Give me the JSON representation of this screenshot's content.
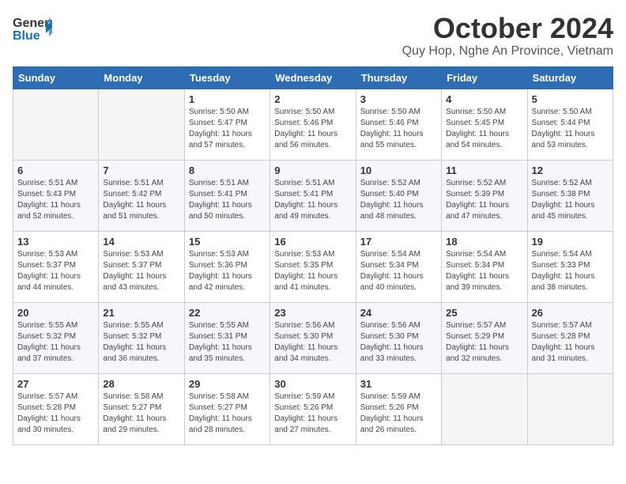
{
  "header": {
    "logo_text_general": "General",
    "logo_text_blue": "Blue",
    "month_title": "October 2024",
    "location": "Quy Hop, Nghe An Province, Vietnam"
  },
  "weekdays": [
    "Sunday",
    "Monday",
    "Tuesday",
    "Wednesday",
    "Thursday",
    "Friday",
    "Saturday"
  ],
  "weeks": [
    [
      {
        "day": null
      },
      {
        "day": null
      },
      {
        "day": "1",
        "sunrise": "5:50 AM",
        "sunset": "5:47 PM",
        "daylight": "11 hours and 57 minutes."
      },
      {
        "day": "2",
        "sunrise": "5:50 AM",
        "sunset": "5:46 PM",
        "daylight": "11 hours and 56 minutes."
      },
      {
        "day": "3",
        "sunrise": "5:50 AM",
        "sunset": "5:46 PM",
        "daylight": "11 hours and 55 minutes."
      },
      {
        "day": "4",
        "sunrise": "5:50 AM",
        "sunset": "5:45 PM",
        "daylight": "11 hours and 54 minutes."
      },
      {
        "day": "5",
        "sunrise": "5:50 AM",
        "sunset": "5:44 PM",
        "daylight": "11 hours and 53 minutes."
      }
    ],
    [
      {
        "day": "6",
        "sunrise": "5:51 AM",
        "sunset": "5:43 PM",
        "daylight": "11 hours and 52 minutes."
      },
      {
        "day": "7",
        "sunrise": "5:51 AM",
        "sunset": "5:42 PM",
        "daylight": "11 hours and 51 minutes."
      },
      {
        "day": "8",
        "sunrise": "5:51 AM",
        "sunset": "5:41 PM",
        "daylight": "11 hours and 50 minutes."
      },
      {
        "day": "9",
        "sunrise": "5:51 AM",
        "sunset": "5:41 PM",
        "daylight": "11 hours and 49 minutes."
      },
      {
        "day": "10",
        "sunrise": "5:52 AM",
        "sunset": "5:40 PM",
        "daylight": "11 hours and 48 minutes."
      },
      {
        "day": "11",
        "sunrise": "5:52 AM",
        "sunset": "5:39 PM",
        "daylight": "11 hours and 47 minutes."
      },
      {
        "day": "12",
        "sunrise": "5:52 AM",
        "sunset": "5:38 PM",
        "daylight": "11 hours and 45 minutes."
      }
    ],
    [
      {
        "day": "13",
        "sunrise": "5:53 AM",
        "sunset": "5:37 PM",
        "daylight": "11 hours and 44 minutes."
      },
      {
        "day": "14",
        "sunrise": "5:53 AM",
        "sunset": "5:37 PM",
        "daylight": "11 hours and 43 minutes."
      },
      {
        "day": "15",
        "sunrise": "5:53 AM",
        "sunset": "5:36 PM",
        "daylight": "11 hours and 42 minutes."
      },
      {
        "day": "16",
        "sunrise": "5:53 AM",
        "sunset": "5:35 PM",
        "daylight": "11 hours and 41 minutes."
      },
      {
        "day": "17",
        "sunrise": "5:54 AM",
        "sunset": "5:34 PM",
        "daylight": "11 hours and 40 minutes."
      },
      {
        "day": "18",
        "sunrise": "5:54 AM",
        "sunset": "5:34 PM",
        "daylight": "11 hours and 39 minutes."
      },
      {
        "day": "19",
        "sunrise": "5:54 AM",
        "sunset": "5:33 PM",
        "daylight": "11 hours and 38 minutes."
      }
    ],
    [
      {
        "day": "20",
        "sunrise": "5:55 AM",
        "sunset": "5:32 PM",
        "daylight": "11 hours and 37 minutes."
      },
      {
        "day": "21",
        "sunrise": "5:55 AM",
        "sunset": "5:32 PM",
        "daylight": "11 hours and 36 minutes."
      },
      {
        "day": "22",
        "sunrise": "5:55 AM",
        "sunset": "5:31 PM",
        "daylight": "11 hours and 35 minutes."
      },
      {
        "day": "23",
        "sunrise": "5:56 AM",
        "sunset": "5:30 PM",
        "daylight": "11 hours and 34 minutes."
      },
      {
        "day": "24",
        "sunrise": "5:56 AM",
        "sunset": "5:30 PM",
        "daylight": "11 hours and 33 minutes."
      },
      {
        "day": "25",
        "sunrise": "5:57 AM",
        "sunset": "5:29 PM",
        "daylight": "11 hours and 32 minutes."
      },
      {
        "day": "26",
        "sunrise": "5:57 AM",
        "sunset": "5:28 PM",
        "daylight": "11 hours and 31 minutes."
      }
    ],
    [
      {
        "day": "27",
        "sunrise": "5:57 AM",
        "sunset": "5:28 PM",
        "daylight": "11 hours and 30 minutes."
      },
      {
        "day": "28",
        "sunrise": "5:58 AM",
        "sunset": "5:27 PM",
        "daylight": "11 hours and 29 minutes."
      },
      {
        "day": "29",
        "sunrise": "5:58 AM",
        "sunset": "5:27 PM",
        "daylight": "11 hours and 28 minutes."
      },
      {
        "day": "30",
        "sunrise": "5:59 AM",
        "sunset": "5:26 PM",
        "daylight": "11 hours and 27 minutes."
      },
      {
        "day": "31",
        "sunrise": "5:59 AM",
        "sunset": "5:26 PM",
        "daylight": "11 hours and 26 minutes."
      },
      {
        "day": null
      },
      {
        "day": null
      }
    ]
  ],
  "labels": {
    "sunrise": "Sunrise:",
    "sunset": "Sunset:",
    "daylight": "Daylight:"
  }
}
